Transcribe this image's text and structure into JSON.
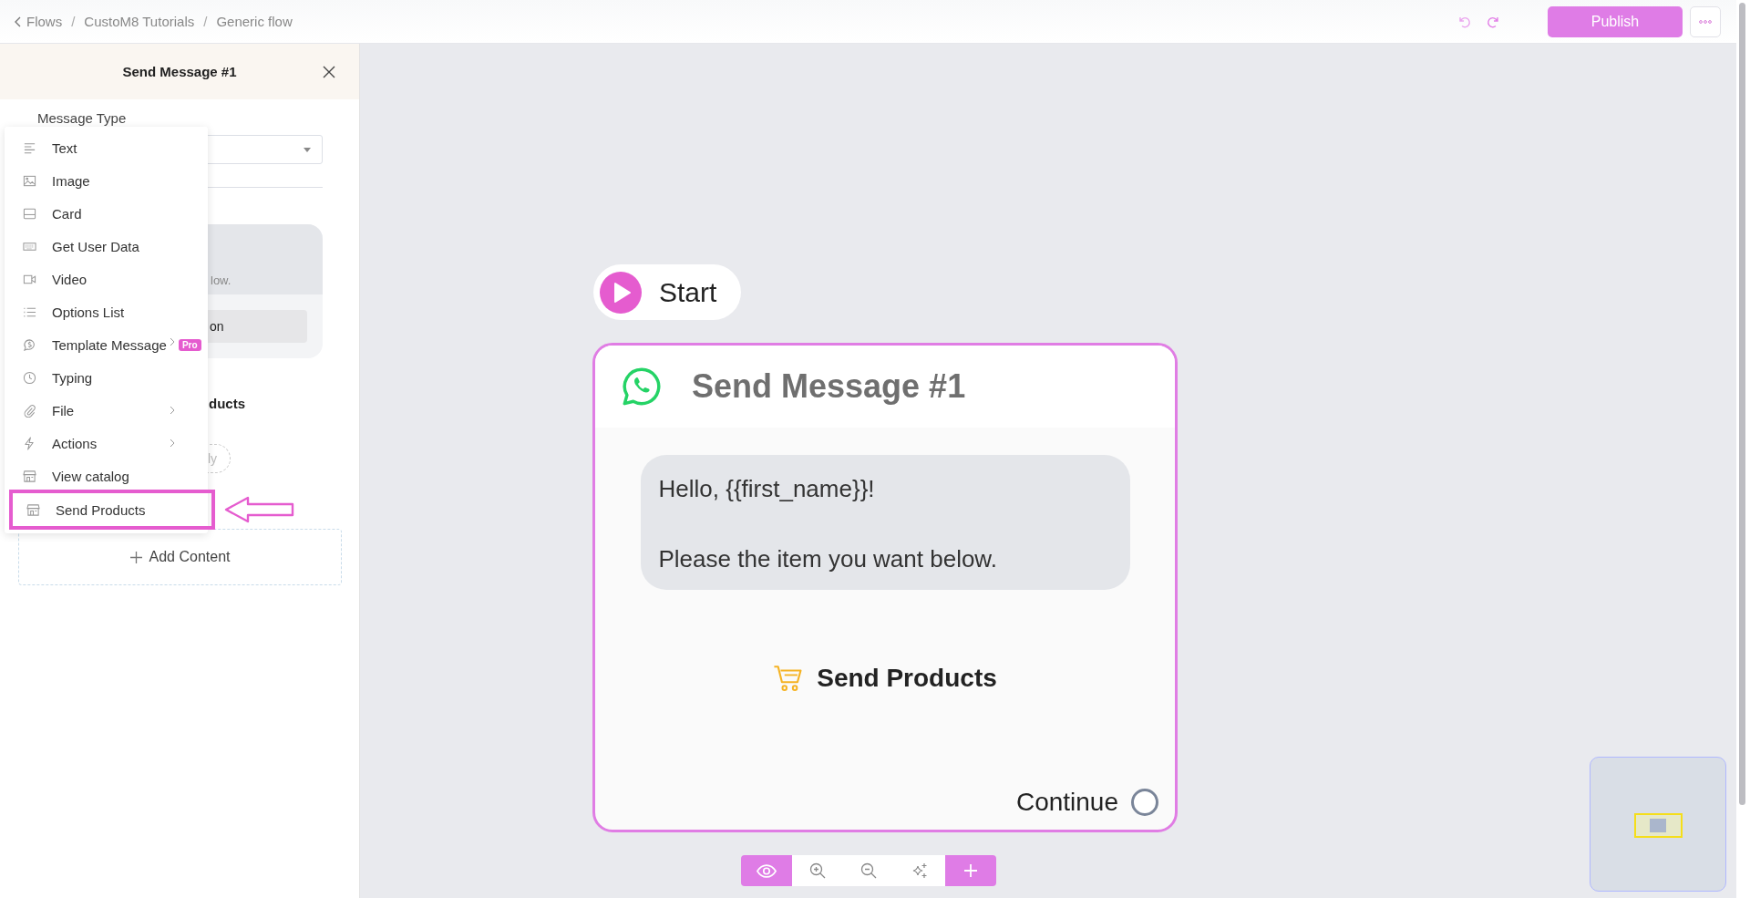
{
  "breadcrumb": {
    "separator": "/",
    "items": [
      {
        "label": "Flows"
      },
      {
        "label": "CustoM8 Tutorials"
      },
      {
        "label": "Generic flow"
      }
    ]
  },
  "header_actions": {
    "publish": "Publish"
  },
  "panel": {
    "title": "Send Message #1",
    "field_label": "Message Type",
    "card_text": "low.",
    "card_button": "on",
    "section_title": "ducts",
    "reply_chip": "ly",
    "add_content": "Add Content"
  },
  "type_menu": {
    "items": [
      {
        "kind": "text",
        "label": "Text",
        "has_submenu": false,
        "selected": false
      },
      {
        "kind": "image",
        "label": "Image",
        "has_submenu": false,
        "selected": false
      },
      {
        "kind": "card",
        "label": "Card",
        "has_submenu": false,
        "selected": false
      },
      {
        "kind": "user_data",
        "label": "Get User Data",
        "has_submenu": false,
        "selected": false
      },
      {
        "kind": "video",
        "label": "Video",
        "has_submenu": false,
        "selected": false
      },
      {
        "kind": "list",
        "label": "Options List",
        "has_submenu": false,
        "selected": false
      },
      {
        "kind": "template",
        "label": "Template Message",
        "has_submenu": true,
        "badge": "Pro",
        "selected": false
      },
      {
        "kind": "typing",
        "label": "Typing",
        "has_submenu": false,
        "selected": false
      },
      {
        "kind": "file",
        "label": "File",
        "has_submenu": true,
        "selected": false
      },
      {
        "kind": "actions",
        "label": "Actions",
        "has_submenu": true,
        "selected": false
      },
      {
        "kind": "catalog",
        "label": "View catalog",
        "has_submenu": false,
        "selected": false
      },
      {
        "kind": "products",
        "label": "Send Products",
        "has_submenu": false,
        "selected": true
      }
    ]
  },
  "canvas": {
    "start": {
      "label": "Start"
    },
    "node": {
      "title": "Send Message #1",
      "message_paragraphs": [
        "Hello, {{first_name}}!",
        "Please the item you want below."
      ],
      "content_label": "Send Products",
      "output_label": "Continue"
    }
  }
}
